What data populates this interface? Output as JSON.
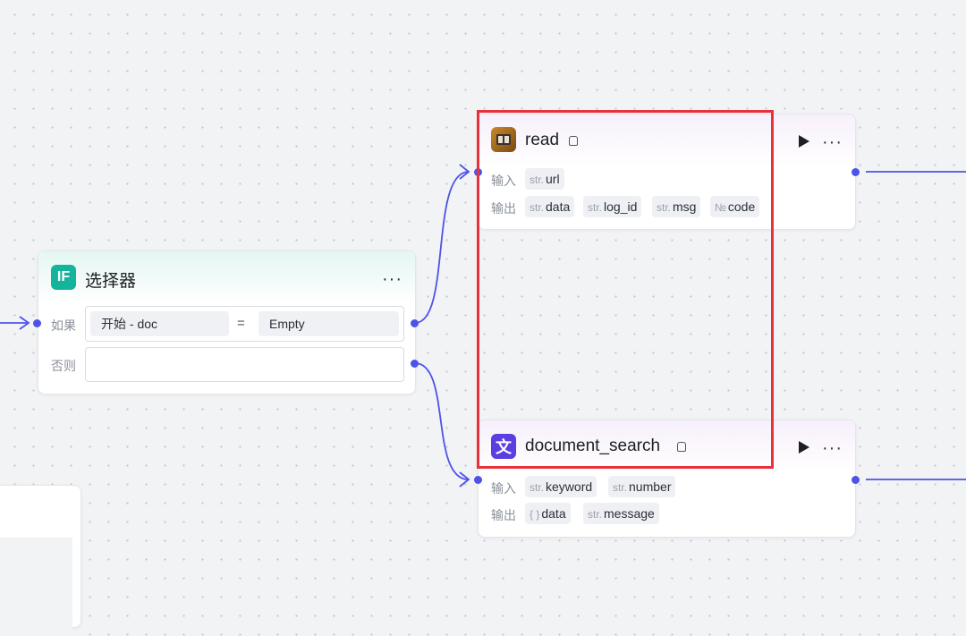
{
  "canvas": {
    "accent": "#4d53e8",
    "highlight_color": "#e8323b"
  },
  "selector_node": {
    "title": "选择器",
    "icon_text": "IF",
    "icon": "if-condition-icon",
    "if_label": "如果",
    "else_label": "否则",
    "condition": {
      "left": "开始  -  doc",
      "operator": "=",
      "right": "Empty"
    }
  },
  "read_node": {
    "title": "read",
    "icon": "book-app-icon",
    "input_label": "输入",
    "output_label": "输出",
    "inputs": [
      {
        "type": "str.",
        "name": "url"
      }
    ],
    "outputs": [
      {
        "type": "str.",
        "name": "data"
      },
      {
        "type": "str.",
        "name": "log_id"
      },
      {
        "type": "str.",
        "name": "msg"
      },
      {
        "type": "№",
        "name": "code"
      }
    ]
  },
  "search_node": {
    "title": "document_search",
    "icon_text": "文",
    "icon": "document-text-icon",
    "input_label": "输入",
    "output_label": "输出",
    "inputs": [
      {
        "type": "str.",
        "name": "keyword"
      },
      {
        "type": "str.",
        "name": "number"
      }
    ],
    "outputs": [
      {
        "type": "{ }",
        "name": "data"
      },
      {
        "type": "str.",
        "name": "message"
      }
    ]
  }
}
